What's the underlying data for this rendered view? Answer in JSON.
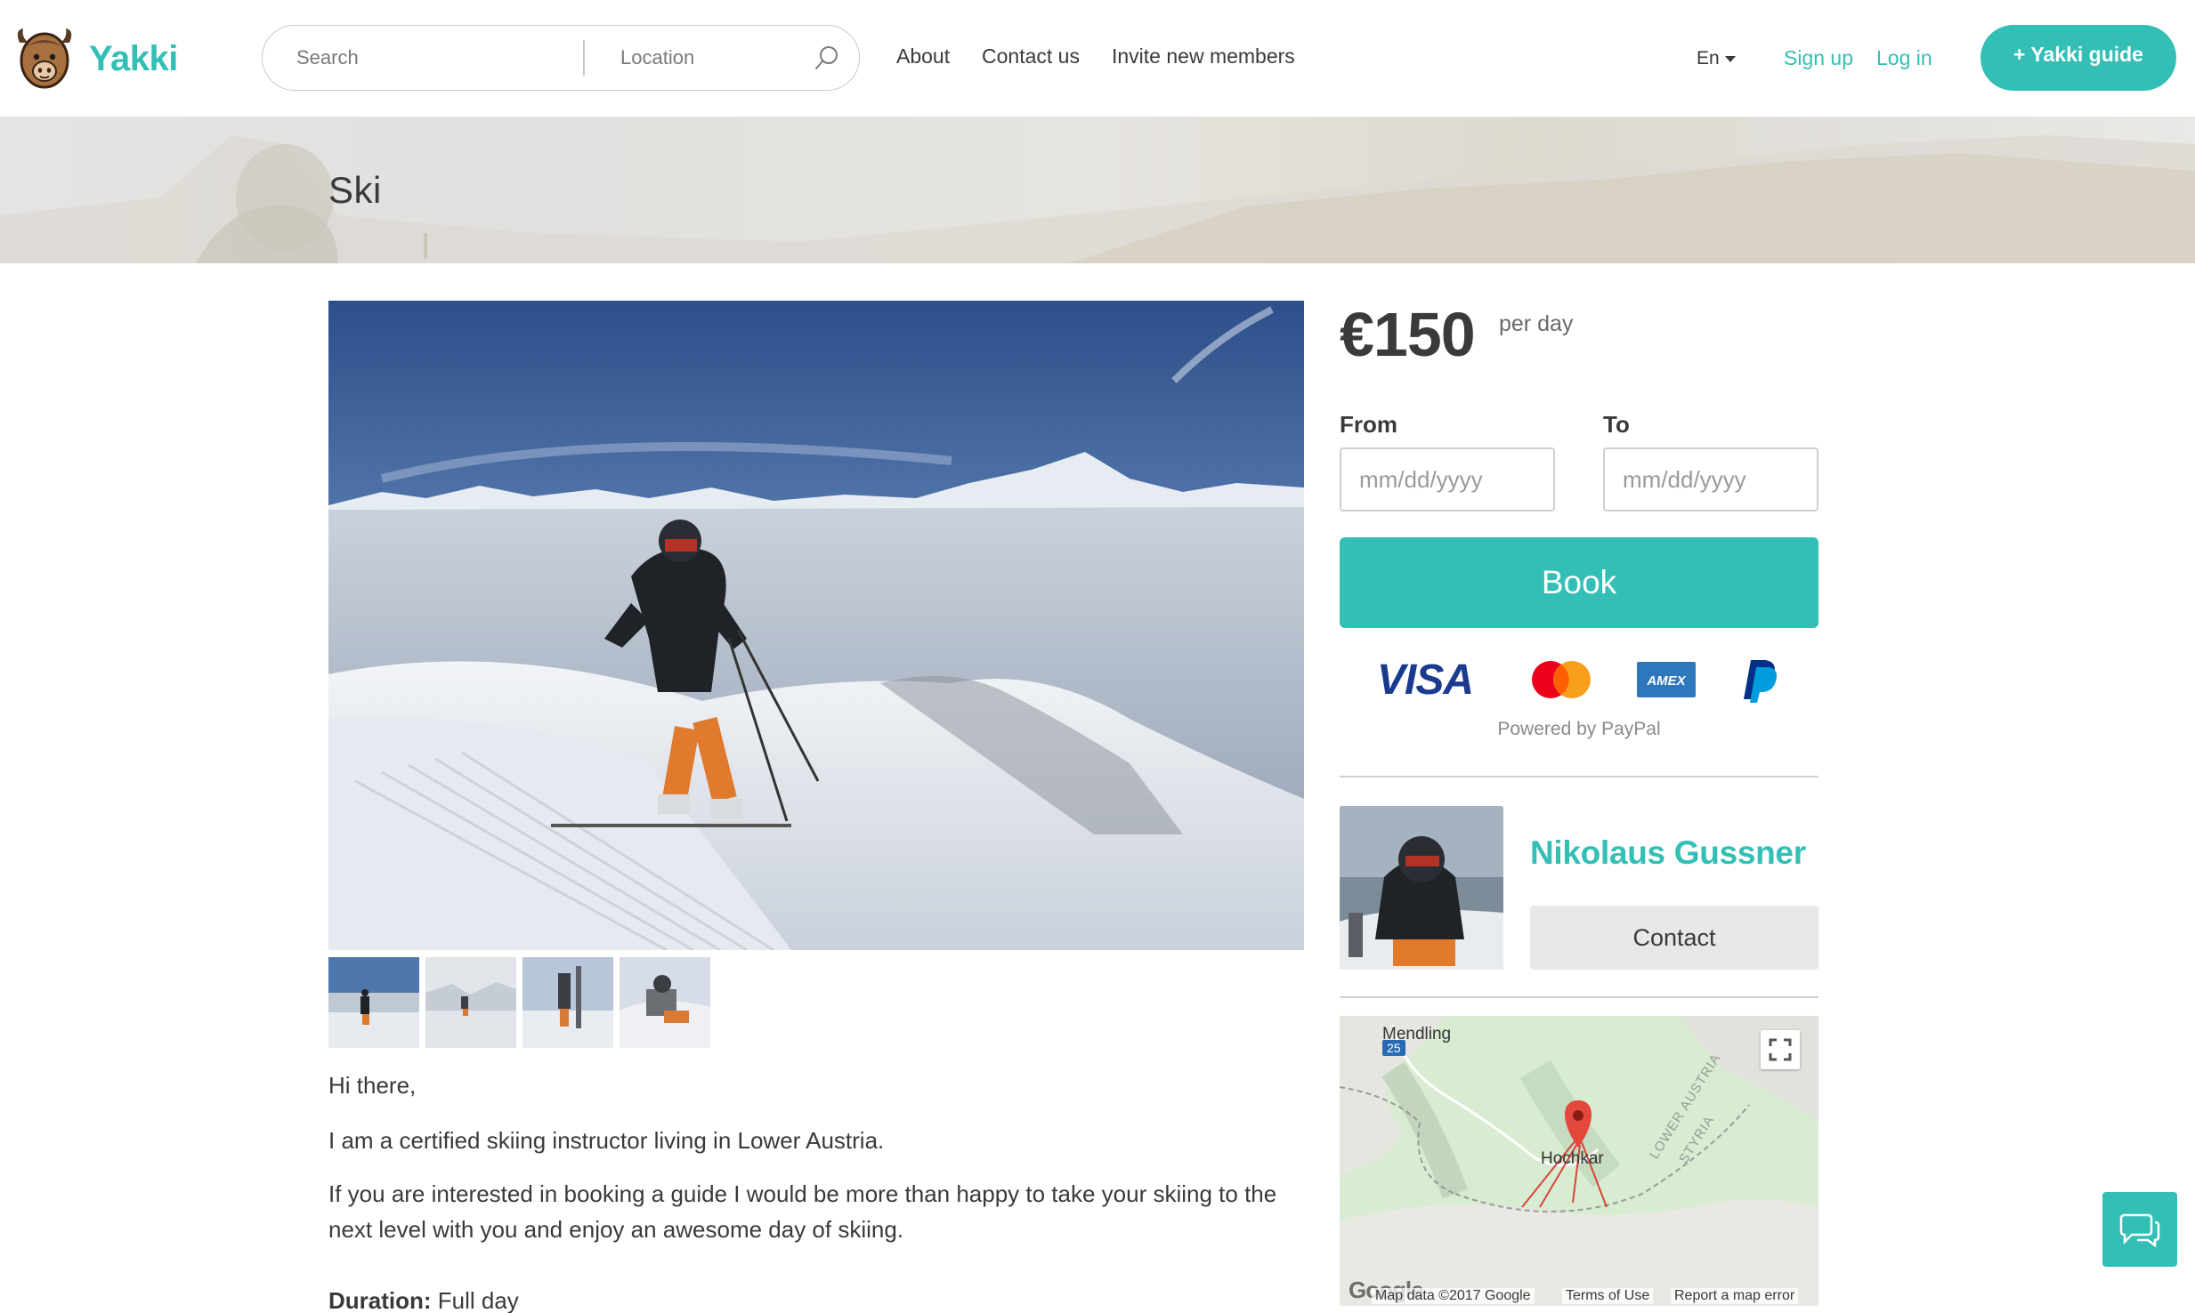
{
  "brand": {
    "name": "Yakki",
    "accent": "#33bfb5"
  },
  "search": {
    "placeholder": "Search",
    "location_placeholder": "Location"
  },
  "nav": {
    "about": "About",
    "contact": "Contact us",
    "invite": "Invite new members"
  },
  "lang": {
    "selected": "En"
  },
  "auth": {
    "signup": "Sign up",
    "login": "Log in"
  },
  "cta": {
    "guide": "+ Yakki guide"
  },
  "hero": {
    "title": "Ski"
  },
  "gallery": {
    "thumb_count": 4
  },
  "description": {
    "greeting": "Hi there,",
    "line1": "I am a certified skiing instructor living in Lower Austria.",
    "line2": "If you are interested in booking a guide I would be more than happy to take your skiing to the next level with you and enjoy an awesome day of skiing.",
    "duration_label": "Duration:",
    "duration_value": " Full day"
  },
  "booking": {
    "price": "€150",
    "unit": "per day",
    "from_label": "From",
    "to_label": "To",
    "date_placeholder": "mm/dd/yyyy",
    "book_label": "Book",
    "payment_methods": [
      "visa-icon",
      "mastercard-icon",
      "amex-icon",
      "paypal-icon"
    ],
    "visa_text": "VISA",
    "amex_text": "AMEX",
    "powered_by": "Powered by PayPal"
  },
  "guide": {
    "name": "Nikolaus Gussner",
    "contact_label": "Contact"
  },
  "map": {
    "place_top": "Mendling",
    "route": "25",
    "place_marker": "Hochkar",
    "region_1": "LOWER AUSTRIA",
    "region_2": "STYRIA",
    "google": "Google",
    "attribution": "Map data ©2017 Google",
    "terms": "Terms of Use",
    "report": "Report a map error"
  }
}
